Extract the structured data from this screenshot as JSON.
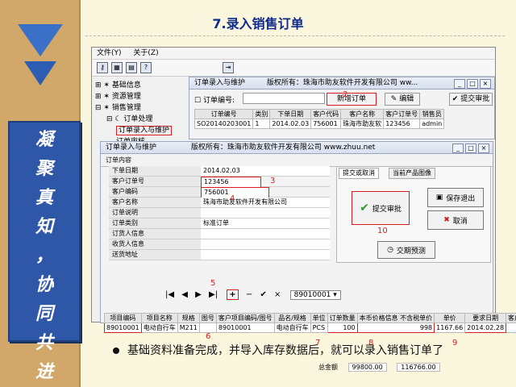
{
  "slide": {
    "title": "7.录入销售订单",
    "left_slogan": [
      "凝",
      "聚",
      "真",
      "知",
      "，",
      "协",
      "同",
      "共",
      "进"
    ],
    "bottom_text": "基础资料准备完成，并导入库存数据后，就可以录入销售订单了"
  },
  "app": {
    "menu": [
      "文件(Y)",
      "关于(Z)"
    ],
    "tree": [
      "基础信息",
      "资源管理",
      "销售管理",
      "订单处理",
      "订单录入与维护",
      "订单审核"
    ],
    "windowA": {
      "title": "订单录入与维护",
      "copyright": "版权所有：珠海市助友软件开发有限公司 ww...",
      "order_no_label": "订单编号:",
      "buttons": {
        "add": "新增订单",
        "edit": "编辑",
        "submit": "提交审批"
      },
      "grid_headers": [
        "订单编号",
        "类别",
        "下单日期",
        "客户代码",
        "客户名称",
        "客户订单号",
        "销售员"
      ],
      "grid_row": [
        "SO20140203001",
        "1",
        "2014.02.03",
        "756001",
        "珠海市助友软",
        "123456",
        "admin"
      ]
    },
    "windowB": {
      "title": "订单录入与维护",
      "copyright": "版权所有：珠海市助友软件开发有限公司 www.zhuu.net",
      "tab_label": "订单内容",
      "fields": [
        {
          "label": "下单日期",
          "value": "2014.02.03"
        },
        {
          "label": "客户订单号",
          "value": "123456"
        },
        {
          "label": "客户编码",
          "value": "756001"
        },
        {
          "label": "客户名称",
          "value": "珠海市助友软件开发有限公司"
        },
        {
          "label": "订单说明",
          "value": ""
        },
        {
          "label": "订单类别",
          "value": "标准订单"
        },
        {
          "label": "订货人信息",
          "value": ""
        },
        {
          "label": "收货人信息",
          "value": ""
        },
        {
          "label": "送货地址",
          "value": ""
        }
      ],
      "right_tabs": [
        "提交或取消",
        "当前产品图像"
      ],
      "buttons": {
        "submit": "提交审批",
        "save_exit": "保存退出",
        "cancel": "取消",
        "delivery": "交期预测"
      },
      "nav_code": "89010001",
      "detail_headers": [
        "项目编码",
        "项目名称",
        "规格",
        "图号",
        "客户项目编码/图号",
        "品名/规格",
        "单位",
        "订单数量",
        "本币价格信息 不含税单价",
        "单价",
        "要求日期",
        "客户"
      ],
      "detail_row": [
        "89010001",
        "电动自行车",
        "M211",
        "",
        "89010001",
        "电动自行车",
        "PCS",
        "100",
        "998",
        "1167.66",
        "2014.02.28",
        ""
      ],
      "total_label": "总金额",
      "totals": [
        "99800.00",
        "116766.00"
      ]
    },
    "annotations": [
      "2",
      "3",
      "4",
      "5",
      "6",
      "7",
      "8",
      "9",
      "10"
    ]
  },
  "colors": {
    "accent": "#d81e1e",
    "title": "#0f2b8a",
    "slogan_bg": "#2f57a8",
    "bg": "#fbf6de",
    "left_panel": "#d2a76a"
  }
}
